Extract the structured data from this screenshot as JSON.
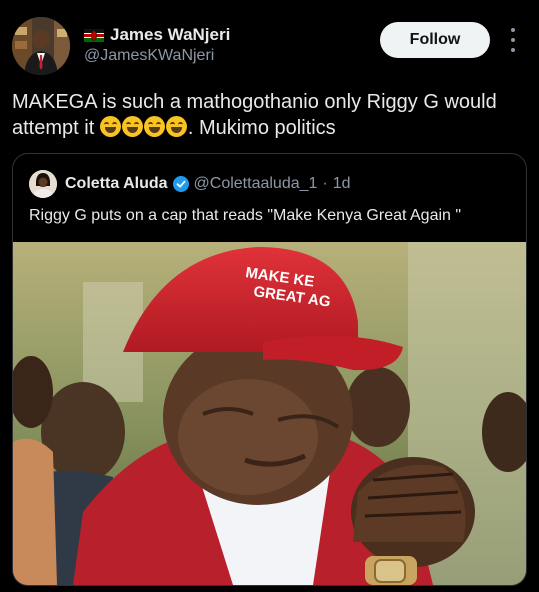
{
  "author": {
    "display_name": "James WaNjeri",
    "handle": "@JamesKWaNjeri",
    "flag_icon": "kenya-flag-icon"
  },
  "follow_label": "Follow",
  "tweet": {
    "text_before": "MAKEGA is such a mathogothanio only Riggy G would attempt it",
    "emoji_count": 4,
    "text_after": ". Mukimo politics"
  },
  "quote": {
    "name": "Coletta Aluda",
    "handle": "@Colettaaluda_1",
    "separator": "·",
    "time": "1d",
    "text": "Riggy G puts on a cap that reads \"Make Kenya Great Again \"",
    "image": {
      "cap_text": "MAKE KENYA\nGREAT AGAIN",
      "description_colors": {
        "cap": "#d81e2a",
        "jacket": "#b8202b"
      }
    }
  },
  "colors": {
    "background": "#000000",
    "text": "#e7e9ea",
    "muted": "#8b98a5",
    "verified": "#1d9bf0",
    "follow_bg": "#eff3f4"
  }
}
